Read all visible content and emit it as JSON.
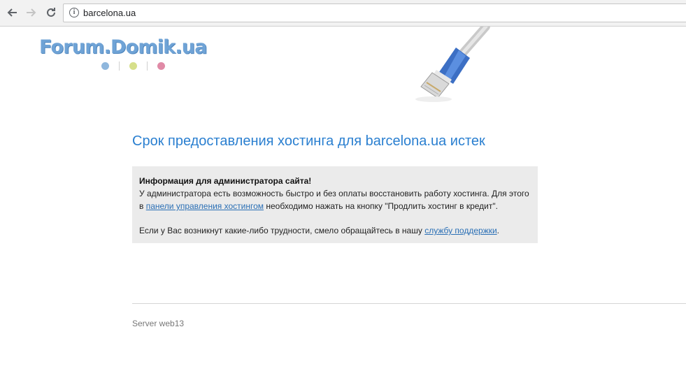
{
  "browser": {
    "url": "barcelona.ua",
    "back_icon": "arrow-left-icon",
    "forward_icon": "arrow-right-icon",
    "reload_icon": "reload-icon",
    "info_icon": "info-icon"
  },
  "logo": {
    "text": "Forum.Domik.ua",
    "color": "#6fa3d6"
  },
  "main": {
    "heading": "Срок предоставления хостинга для barcelona.ua истек",
    "heading_color": "#2a7fd0",
    "notice": {
      "title": "Информация для администратора сайта!",
      "line1": "У администратора есть возможность быстро и без оплаты восстановить работу хостинга. Для этого в ",
      "link1": "панели управления хостингом",
      "line1_end": " необходимо нажать на кнопку \"Продлить хостинг в кредит\".",
      "line2": "Если у Вас возникнут какие-либо трудности, смело обращайтесь в нашу ",
      "link2": "службу поддержки",
      "line2_end": "."
    }
  },
  "footer": {
    "server": "Server web13"
  }
}
